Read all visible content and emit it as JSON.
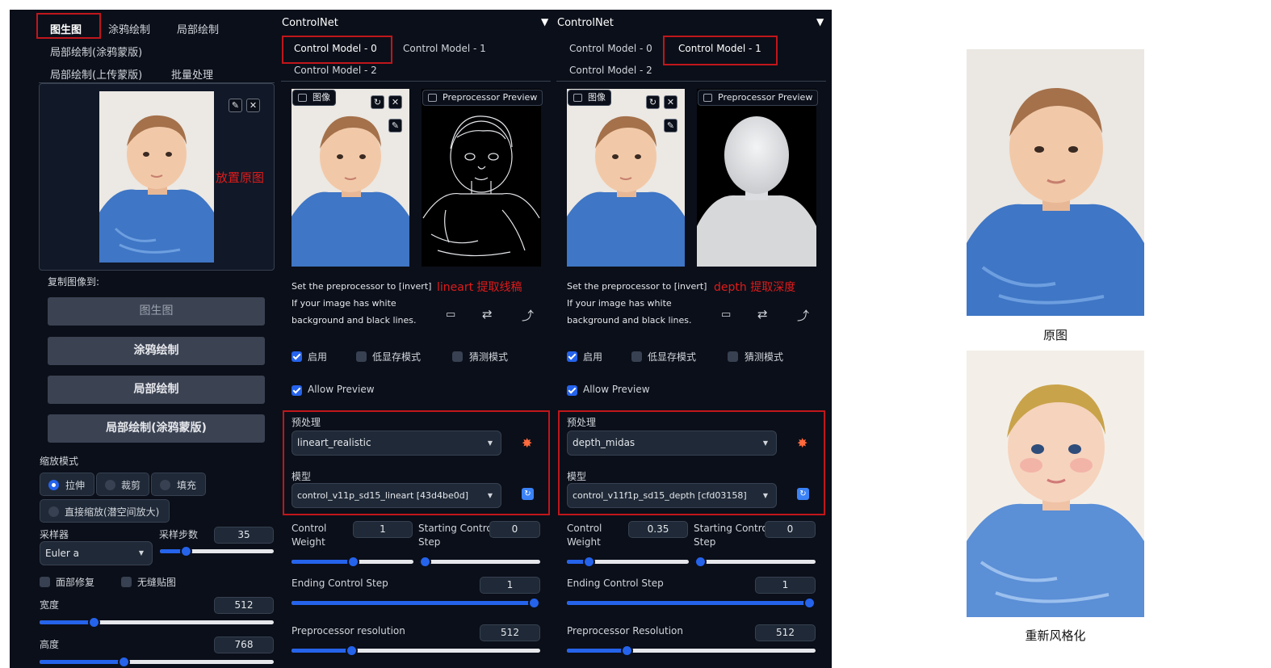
{
  "left_panel": {
    "tabs": [
      "图生图",
      "涂鸦绘制",
      "局部绘制",
      "局部绘制(涂鸦蒙版)",
      "局部绘制(上传蒙版)",
      "批量处理"
    ],
    "copy_to_label": "复制图像到:",
    "copy_buttons": [
      "图生图",
      "涂鸦绘制",
      "局部绘制",
      "局部绘制(涂鸦蒙版)"
    ],
    "resize_mode_label": "缩放模式",
    "resize_modes": [
      "拉伸",
      "裁剪",
      "填充",
      "直接缩放(潜空间放大)"
    ],
    "sampler_label": "采样器",
    "sampler_value": "Euler a",
    "steps_label": "采样步数",
    "steps_value": "35",
    "steps_fraction": 0.23,
    "face_restore_label": "面部修复",
    "tiling_label": "无缝贴图",
    "width_label": "宽度",
    "width_value": "512",
    "width_fraction": 0.23,
    "height_label": "高度",
    "height_value": "768",
    "height_fraction": 0.36
  },
  "annotations": {
    "place_original": "放置原图",
    "lineart_note": "lineart 提取线稿",
    "depth_note": "depth 提取深度"
  },
  "controlnets": [
    {
      "header": "ControlNet",
      "tabs": [
        "Control Model - 0",
        "Control Model - 1",
        "Control Model - 2"
      ],
      "selected_tab": "Control Model - 0",
      "image_label": "图像",
      "preview_label": "Preprocessor Preview",
      "preview_kind": "lineart",
      "hint": [
        "Set the preprocessor to [invert]",
        "If your image has white",
        "background and black lines."
      ],
      "enable_label": "启用",
      "lowvram_label": "低显存模式",
      "guess_label": "猜测模式",
      "allow_preview_label": "Allow Preview",
      "preprocessor_label": "预处理",
      "preprocessor_value": "lineart_realistic",
      "model_label": "模型",
      "model_value": "control_v11p_sd15_lineart [43d4be0d]",
      "weight_label": [
        "Control",
        "Weight"
      ],
      "weight_value": "1",
      "weight_fraction": 0.5,
      "start_label": [
        "Starting Control",
        "Step"
      ],
      "start_value": "0",
      "start_fraction": 0,
      "end_label": "Ending Control Step",
      "end_value": "1",
      "end_fraction": 1,
      "res_label": "Preprocessor resolution",
      "res_value": "512",
      "res_fraction": 0.24
    },
    {
      "header": "ControlNet",
      "tabs": [
        "Control Model - 0",
        "Control Model - 1",
        "Control Model - 2"
      ],
      "selected_tab": "Control Model - 1",
      "image_label": "图像",
      "preview_label": "Preprocessor Preview",
      "preview_kind": "depth",
      "hint": [
        "Set the preprocessor to [invert]",
        "If your image has white",
        "background and black lines."
      ],
      "enable_label": "启用",
      "lowvram_label": "低显存模式",
      "guess_label": "猜测模式",
      "allow_preview_label": "Allow Preview",
      "preprocessor_label": "预处理",
      "preprocessor_value": "depth_midas",
      "model_label": "模型",
      "model_value": "control_v11f1p_sd15_depth [cfd03158]",
      "weight_label": [
        "Control",
        "Weight"
      ],
      "weight_value": "0.35",
      "weight_fraction": 0.18,
      "start_label": [
        "Starting Control",
        "Step"
      ],
      "start_value": "0",
      "start_fraction": 0,
      "end_label": "Ending Control Step",
      "end_value": "1",
      "end_fraction": 1,
      "res_label": "Preprocessor Resolution",
      "res_value": "512",
      "res_fraction": 0.24
    }
  ],
  "results": {
    "original_caption": "原图",
    "restyled_caption": "重新风格化"
  },
  "colors": {
    "bg": "#0b0f19",
    "accent": "#2563eb",
    "annotation_red": "#e01b1b"
  }
}
